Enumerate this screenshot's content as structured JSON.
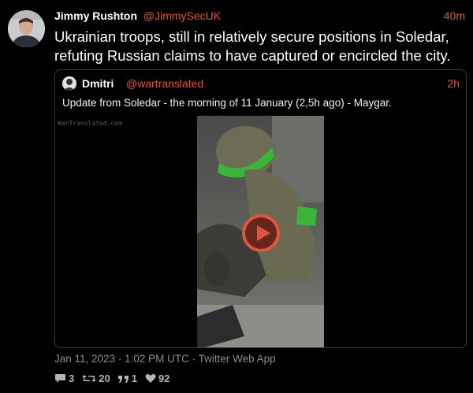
{
  "tweet": {
    "author_name": "Jimmy Rushton",
    "author_handle": "@JimmySecUK",
    "time_ago": "40m",
    "text": "Ukrainian troops, still in relatively secure positions in Soledar, refuting Russian claims to have captured or encircled the city."
  },
  "quote": {
    "author_name": "Dmitri",
    "author_handle": "@wartranslated",
    "time_ago": "2h",
    "text": "Update from Soledar - the morning of 11 January (2,5h ago) - Maygar.",
    "video_watermark": "WarTranslated.com"
  },
  "meta": {
    "timestamp": "Jan 11, 2023 · 1:02 PM UTC · Twitter Web App"
  },
  "stats": {
    "replies": "3",
    "retweets": "20",
    "quotes": "1",
    "likes": "92"
  },
  "colors": {
    "accent": "#e0553f",
    "background": "#000000"
  },
  "icons": {
    "reply": "comment-icon",
    "retweet": "retweet-icon",
    "quote": "quote-icon",
    "like": "heart-icon",
    "play": "play-icon"
  }
}
